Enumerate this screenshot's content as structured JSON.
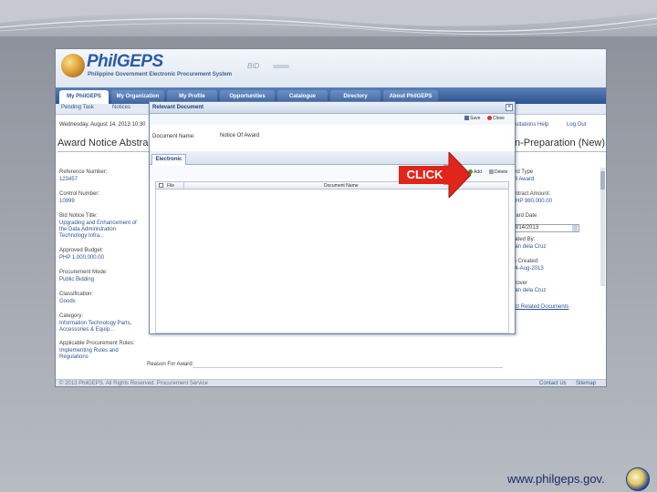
{
  "brand": {
    "logo_text": "PhilGEPS",
    "logo_subtitle": "Philippine Government Electronic Procurement System",
    "bid_label": "BID"
  },
  "nav": {
    "tabs": [
      "My PhilGEPS",
      "My Organization",
      "My Profile",
      "Opportunities",
      "Catalogue",
      "Directory",
      "About PhilGEPS"
    ],
    "active_tab": "My PhilGEPS"
  },
  "subnav": {
    "items": [
      "Pending Task",
      "Notices"
    ]
  },
  "header": {
    "date_line": "Wednesday, August 14, 2013 10:30",
    "right_text": "ultations   Help",
    "logout": "Log Out"
  },
  "page": {
    "title_left": "Award Notice Abstrac",
    "title_right": "n-Preparation (New)"
  },
  "left_form": {
    "fields": [
      {
        "label": "Reference Number:",
        "value": "123457"
      },
      {
        "label": "Control Number:",
        "value": "10999"
      },
      {
        "label": "Bid Notice Title:",
        "value": "Upgrading and Enhancement of\nthe Data Administration\nTechnology Infra..."
      },
      {
        "label": "Approved Budget:",
        "value": "PHP 1,000,000.00"
      },
      {
        "label": "Procurement Mode:",
        "value": "Public Bidding"
      },
      {
        "label": "Classification:",
        "value": "Goods"
      },
      {
        "label": "Category:",
        "value": "Information Technology Parts,\nAccessories & Equip..."
      },
      {
        "label": "Applicable Procurement Rules:",
        "value": "Implementing Rules and\nRegulations"
      }
    ]
  },
  "right_form": {
    "fields": [
      {
        "label": "ard Type",
        "value": "ull Award"
      },
      {
        "label": "ontract Amount:",
        "value": "PHP 980,000.00"
      },
      {
        "label": "ward Date",
        "value": "08/14/2013"
      },
      {
        "label": "eated By:",
        "value": "uan dela Cruz"
      },
      {
        "label": "te Created:",
        "value": "14-Aug-2013"
      },
      {
        "label": "prover",
        "value": "uan dela Cruz"
      }
    ],
    "link": "ect Related Documents"
  },
  "reason": {
    "label": "Reason For Award:"
  },
  "footer": {
    "copyright": "© 2013 PhilGEPS. All Rights Reserved. Procurement Service",
    "contact": "Contact Us",
    "sitemap": "Sitemap"
  },
  "dialog": {
    "title": "Relevant Document",
    "toolbar": {
      "save": "Save",
      "close": "Close"
    },
    "field_label": "Document Name:",
    "field_value": "Notice Of Award",
    "tab": "Electronic",
    "inner_toolbar": {
      "add": "Add",
      "delete": "Delete"
    },
    "grid_columns": [
      "File",
      "Document Name"
    ]
  },
  "callout": {
    "text": "CLICK",
    "color": "#e1251b"
  },
  "slide": {
    "url": "www.philgeps.gov."
  },
  "colors": {
    "nav_blue": "#2d5492",
    "link_blue": "#35598f",
    "callout_red": "#e1251b"
  }
}
